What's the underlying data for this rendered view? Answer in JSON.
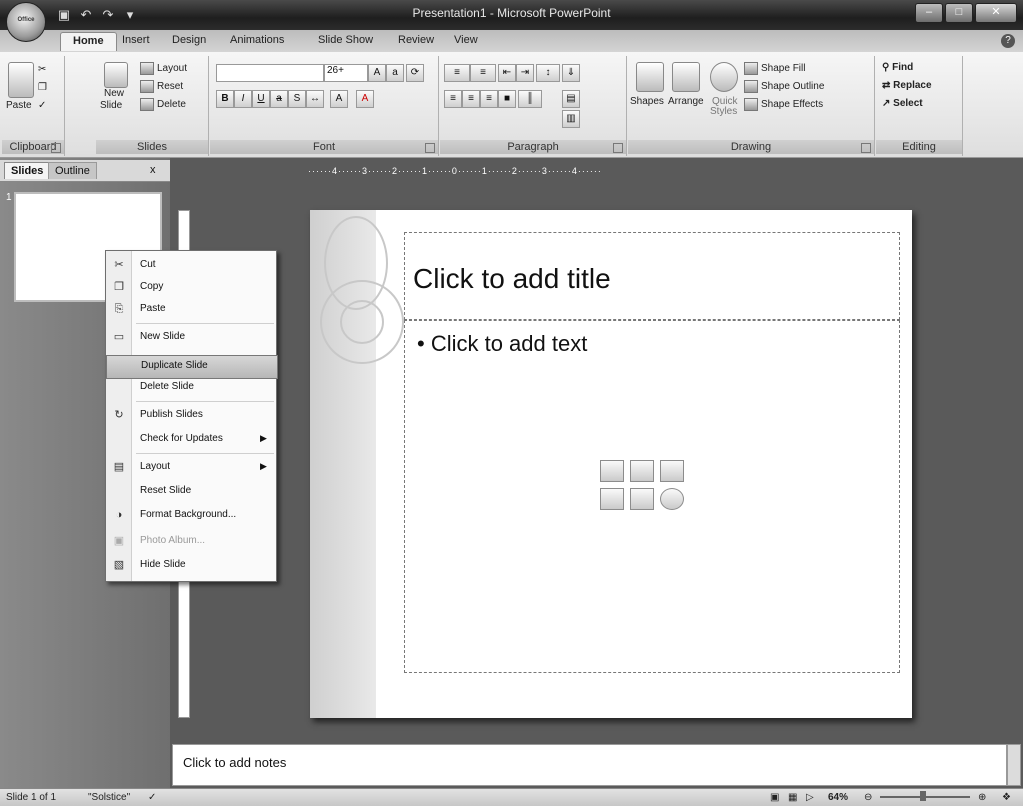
{
  "window": {
    "title": "Presentation1 - Microsoft PowerPoint",
    "office_button_label": "Office"
  },
  "qat": {
    "save_icon": "save-icon",
    "undo_icon": "undo-icon",
    "redo_icon": "redo-icon"
  },
  "tabs": [
    "Home",
    "Insert",
    "Design",
    "Animations",
    "Slide Show",
    "Review",
    "View"
  ],
  "ribbon": {
    "clipboard": {
      "label": "Clipboard",
      "paste": "Paste"
    },
    "slides": {
      "label": "Slides",
      "new_slide_line1": "New",
      "new_slide_line2": "Slide",
      "layout": "Layout",
      "reset": "Reset",
      "delete": "Delete"
    },
    "font": {
      "label": "Font",
      "size": "26+"
    },
    "paragraph": {
      "label": "Paragraph"
    },
    "drawing": {
      "label": "Drawing",
      "shapes": "Shapes",
      "arrange": "Arrange",
      "quick_styles_line1": "Quick",
      "quick_styles_line2": "Styles",
      "shape_fill": "Shape Fill",
      "shape_outline": "Shape Outline",
      "shape_effects": "Shape Effects"
    },
    "editing": {
      "label": "Editing",
      "find": "Find",
      "replace": "Replace",
      "select": "Select"
    }
  },
  "pane": {
    "tab_slides": "Slides",
    "tab_outline": "Outline",
    "close": "x",
    "thumb_number": "1"
  },
  "ruler": {
    "text": "······4······3······2······1······0······1······2······3······4······"
  },
  "slide": {
    "title_placeholder": "Click to add title",
    "body_placeholder": "• Click to add text"
  },
  "context_menu": [
    {
      "label": "Cut",
      "icon": "cut-icon",
      "glyph": "✂"
    },
    {
      "label": "Copy",
      "icon": "copy-icon",
      "glyph": "❐"
    },
    {
      "label": "Paste",
      "icon": "paste-icon",
      "glyph": "⎘"
    },
    {
      "label": "New Slide",
      "icon": "new-slide-icon",
      "glyph": "▭"
    },
    {
      "label": "Duplicate Slide",
      "highlighted": true
    },
    {
      "label": "Delete Slide"
    },
    {
      "label": "Publish Slides",
      "icon": "publish-icon",
      "glyph": "↻"
    },
    {
      "label": "Check for Updates",
      "submenu": true
    },
    {
      "label": "Layout",
      "icon": "layout-icon",
      "glyph": "▤",
      "submenu": true
    },
    {
      "label": "Reset Slide"
    },
    {
      "label": "Format Background...",
      "icon": "format-background-icon",
      "glyph": "◑"
    },
    {
      "label": "Photo Album...",
      "icon": "photo-album-icon",
      "glyph": "▣",
      "disabled": true
    },
    {
      "label": "Hide Slide",
      "icon": "hide-slide-icon",
      "glyph": "▧"
    }
  ],
  "notes": {
    "placeholder": "Click to add notes"
  },
  "status": {
    "slide_info": "Slide 1 of 1",
    "theme": "\"Solstice\"",
    "zoom": "64%"
  }
}
